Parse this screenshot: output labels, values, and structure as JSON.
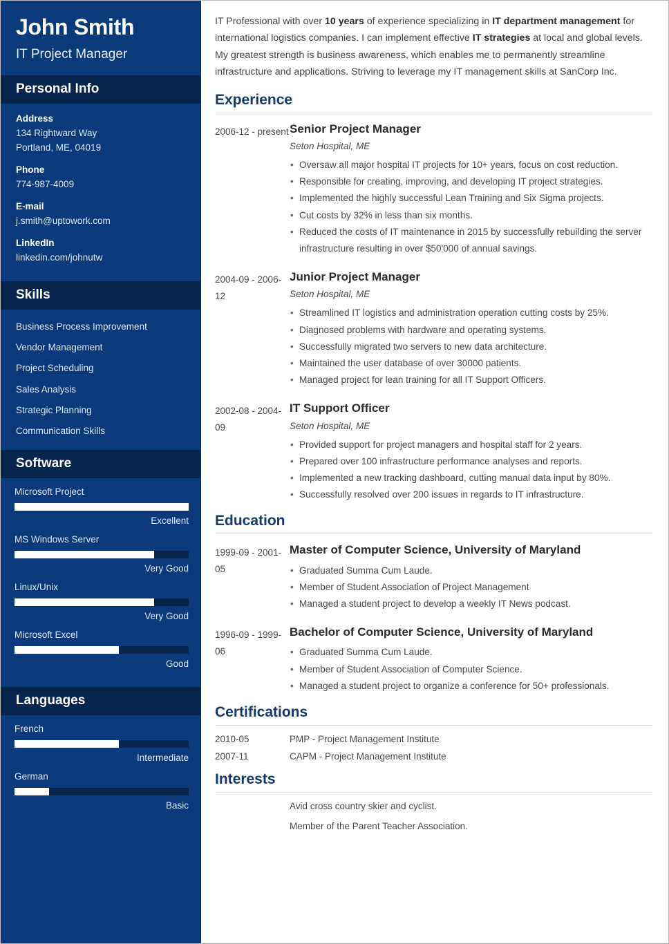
{
  "sidebar": {
    "full_name": "John Smith",
    "job_title": "IT Project Manager",
    "personal_info": {
      "header": "Personal Info",
      "items": [
        {
          "label": "Address",
          "value": "134 Rightward Way\nPortland, ME, 04019"
        },
        {
          "label": "Phone",
          "value": "774-987-4009"
        },
        {
          "label": "E-mail",
          "value": "j.smith@uptowork.com"
        },
        {
          "label": "LinkedIn",
          "value": "linkedin.com/johnutw"
        }
      ]
    },
    "skills": {
      "header": "Skills",
      "items": [
        "Business Process Improvement",
        "Vendor Management",
        "Project Scheduling",
        "Sales Analysis",
        "Strategic Planning",
        "Communication Skills"
      ]
    },
    "software": {
      "header": "Software",
      "items": [
        {
          "name": "Microsoft Project",
          "level": "Excellent",
          "percent": 100
        },
        {
          "name": "MS Windows Server",
          "level": "Very Good",
          "percent": 80
        },
        {
          "name": "Linux/Unix",
          "level": "Very Good",
          "percent": 80
        },
        {
          "name": "Microsoft Excel",
          "level": "Good",
          "percent": 60
        }
      ]
    },
    "languages": {
      "header": "Languages",
      "items": [
        {
          "name": "French",
          "level": "Intermediate",
          "percent": 60
        },
        {
          "name": "German",
          "level": "Basic",
          "percent": 20
        }
      ]
    }
  },
  "main": {
    "summary": {
      "part1": "IT Professional with over ",
      "bold1": "10 years",
      "part2": " of experience specializing in ",
      "bold2": "IT department management",
      "part3": " for international logistics companies. I can implement effective ",
      "bold3": "IT strategies",
      "part4": " at local and global levels. My greatest strength is business awareness, which enables me to permanently streamline infrastructure and applications. Striving to leverage my IT management skills at SanCorp Inc."
    },
    "experience": {
      "header": "Experience",
      "entries": [
        {
          "date": "2006-12 - present",
          "title": "Senior Project Manager",
          "subtitle": "Seton Hospital, ME",
          "bullets": [
            "Oversaw all major hospital IT projects for 10+ years, focus on cost reduction.",
            "Responsible for creating, improving, and developing IT project strategies.",
            "Implemented the highly successful Lean Training and Six Sigma projects.",
            "Cut costs by 32% in less than six months.",
            "Reduced the costs of IT maintenance in 2015 by successfully rebuilding the server infrastructure resulting in over $50'000 of annual savings."
          ]
        },
        {
          "date": "2004-09 - 2006-12",
          "title": "Junior Project Manager",
          "subtitle": "Seton Hospital, ME",
          "bullets": [
            "Streamlined IT logistics and administration operation cutting costs by 25%.",
            "Diagnosed problems with hardware and operating systems.",
            "Successfully migrated two servers to new data architecture.",
            "Maintained the user database of over 30000 patients.",
            "Managed project for lean training for all IT Support Officers."
          ]
        },
        {
          "date": "2002-08 - 2004-09",
          "title": "IT Support Officer",
          "subtitle": "Seton Hospital, ME",
          "bullets": [
            "Provided support for project managers and hospital staff for 2 years.",
            "Prepared over 100 infrastructure performance analyses and reports.",
            "Implemented a new tracking dashboard, cutting manual data input by 80%.",
            "Successfully resolved over 200 issues in regards to IT infrastructure."
          ]
        }
      ]
    },
    "education": {
      "header": "Education",
      "entries": [
        {
          "date": "1999-09 - 2001-05",
          "title": "Master of Computer Science, University of Maryland",
          "subtitle": "",
          "bullets": [
            "Graduated Summa Cum Laude.",
            "Member of Student Association of Project Management",
            "Managed a student project to develop a weekly IT News podcast."
          ]
        },
        {
          "date": "1996-09 - 1999-06",
          "title": "Bachelor of Computer Science, University of Maryland",
          "subtitle": "",
          "bullets": [
            "Graduated Summa Cum Laude.",
            "Member of Student Association of Computer Science.",
            "Managed a student project to organize a conference for 50+ professionals."
          ]
        }
      ]
    },
    "certifications": {
      "header": "Certifications",
      "rows": [
        {
          "date": "2010-05",
          "text": "PMP - Project Management Institute"
        },
        {
          "date": "2007-11",
          "text": "CAPM - Project Management Institute"
        }
      ]
    },
    "interests": {
      "header": "Interests",
      "rows": [
        "Avid cross country skier and cyclist.",
        "Member of the Parent Teacher Association."
      ]
    }
  },
  "colors": {
    "sidebar_bg": "#0b3a7a",
    "sidebar_band": "#07244c",
    "heading": "#123a6e",
    "bar_fill": "#ffffff"
  }
}
